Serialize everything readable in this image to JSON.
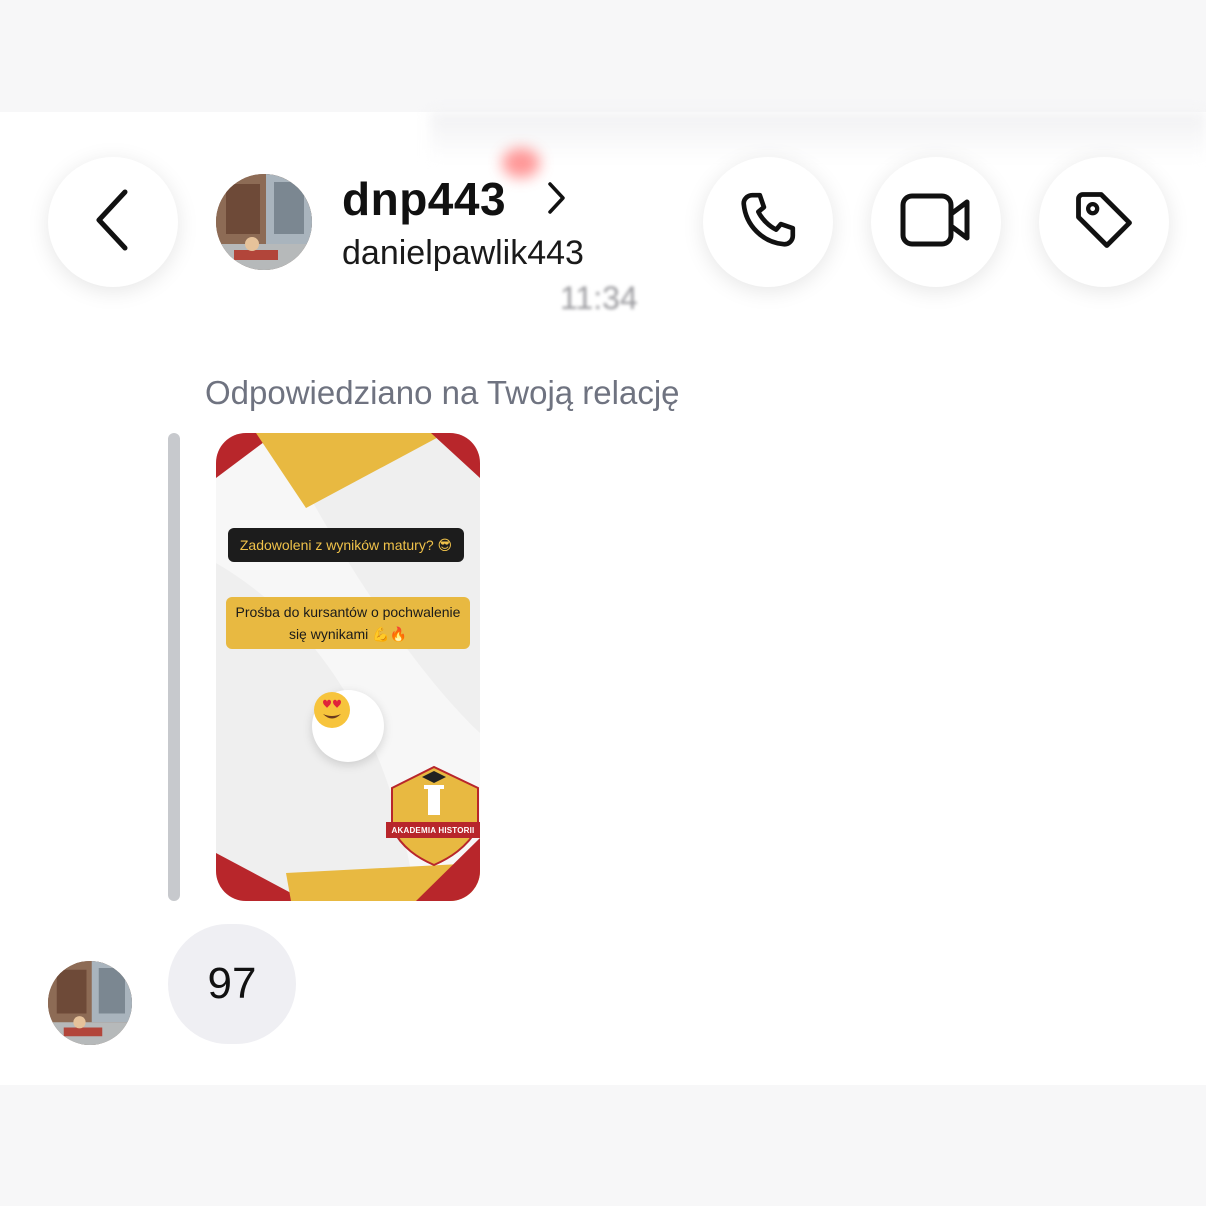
{
  "header": {
    "display_name": "dnp443",
    "username": "danielpawlik443",
    "back_icon": "chevron-left-icon",
    "profile_chevron_icon": "chevron-right-icon",
    "call_icon": "phone-icon",
    "video_icon": "video-camera-icon",
    "tag_icon": "tag-icon"
  },
  "thread": {
    "timestamp": "11:34",
    "reply_caption": "Odpowiedziano na Twoją relację",
    "story": {
      "question_text": "Zadowoleni z wyników matury? 😎",
      "prompt_text": "Prośba do kursantów o pochwalenie się wynikami 💪🔥",
      "reaction_emoji": "😍",
      "badge_text": "AKADEMIA HISTORII",
      "colors": {
        "red": "#b8262b",
        "gold": "#e8b941"
      }
    },
    "message": {
      "text": "97"
    }
  }
}
